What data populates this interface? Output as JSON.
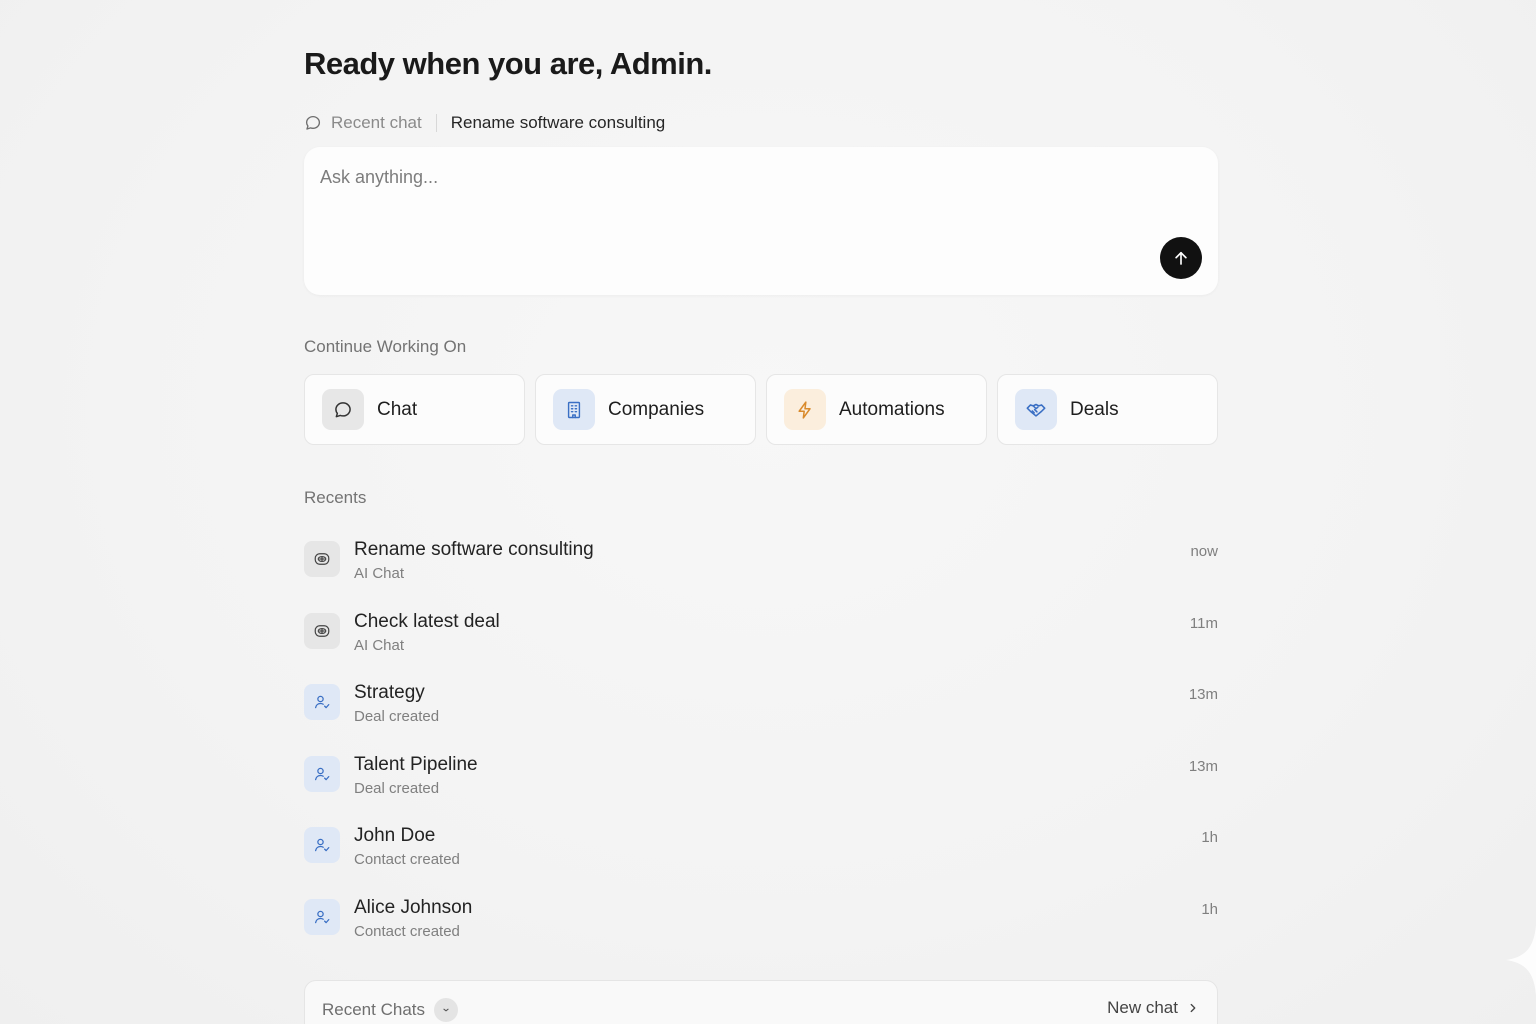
{
  "greeting": "Ready when you are, Admin.",
  "recent_chat": {
    "label": "Recent chat",
    "title": "Rename software consulting",
    "icon": "chat-bubble-icon"
  },
  "ask": {
    "placeholder": "Ask anything...",
    "value": "",
    "send_icon": "arrow-up-icon"
  },
  "continue_working": {
    "title": "Continue Working On",
    "cards": [
      {
        "label": "Chat",
        "icon": "chat-bubble-icon",
        "bg": "#e7e7e7",
        "color": "#333333"
      },
      {
        "label": "Companies",
        "icon": "building-icon",
        "bg": "#dfe8f6",
        "color": "#3a6fc4"
      },
      {
        "label": "Automations",
        "icon": "lightning-icon",
        "bg": "#fbeedd",
        "color": "#d98a2b"
      },
      {
        "label": "Deals",
        "icon": "handshake-icon",
        "bg": "#dfe8f6",
        "color": "#3a6fc4"
      }
    ]
  },
  "recents": {
    "title": "Recents",
    "items": [
      {
        "title": "Rename software consulting",
        "subtitle": "AI Chat",
        "time": "now",
        "icon": "ai-chat-icon",
        "bg": "#e6e6e6"
      },
      {
        "title": "Check latest deal",
        "subtitle": "AI Chat",
        "time": "11m",
        "icon": "ai-chat-icon",
        "bg": "#e6e6e6"
      },
      {
        "title": "Strategy",
        "subtitle": "Deal created",
        "time": "13m",
        "icon": "user-add-icon",
        "bg": "#dfe8f6"
      },
      {
        "title": "Talent Pipeline",
        "subtitle": "Deal created",
        "time": "13m",
        "icon": "user-add-icon",
        "bg": "#dfe8f6"
      },
      {
        "title": "John Doe",
        "subtitle": "Contact created",
        "time": "1h",
        "icon": "user-add-icon",
        "bg": "#dfe8f6"
      },
      {
        "title": "Alice Johnson",
        "subtitle": "Contact created",
        "time": "1h",
        "icon": "user-add-icon",
        "bg": "#dfe8f6"
      }
    ]
  },
  "recent_chats_panel": {
    "title": "Recent Chats",
    "toggle_icon": "chevron-down-icon",
    "new_chat": "New chat",
    "new_chat_icon": "chevron-right-icon"
  }
}
